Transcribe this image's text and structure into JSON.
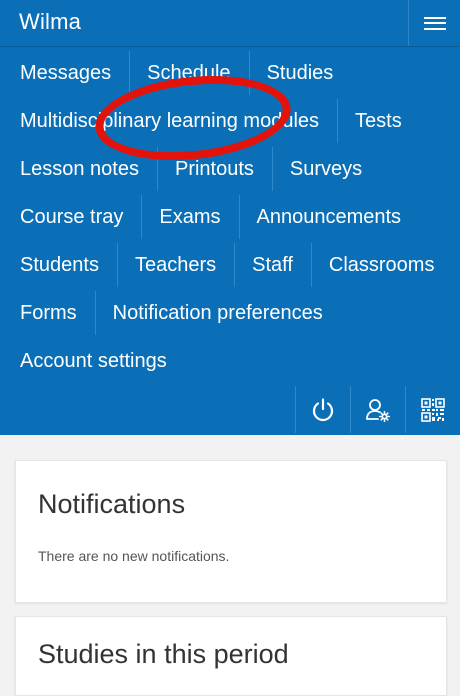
{
  "header": {
    "app_title": "Wilma",
    "menu_icon": "hamburger-menu-icon"
  },
  "nav": {
    "rows": [
      [
        "Messages",
        "Schedule",
        "Studies"
      ],
      [
        "Multidisciplinary learning modules",
        "Tests"
      ],
      [
        "Lesson notes",
        "Printouts",
        "Surveys"
      ],
      [
        "Course tray",
        "Exams",
        "Announcements"
      ],
      [
        "Students",
        "Teachers",
        "Staff",
        "Classrooms"
      ],
      [
        "Forms",
        "Notification preferences"
      ],
      [
        "Account settings"
      ]
    ],
    "actions": [
      {
        "name": "logout-icon"
      },
      {
        "name": "user-settings-icon"
      },
      {
        "name": "qr-code-icon"
      }
    ]
  },
  "annotation": {
    "highlight_color": "#e3120b",
    "highlighted_item": "Schedule"
  },
  "colors": {
    "brand_blue": "#0b6fb8",
    "page_bg": "#f2f2f2"
  },
  "notifications": {
    "title": "Notifications",
    "empty_text": "There are no new notifications."
  },
  "studies": {
    "title": "Studies in this period"
  }
}
